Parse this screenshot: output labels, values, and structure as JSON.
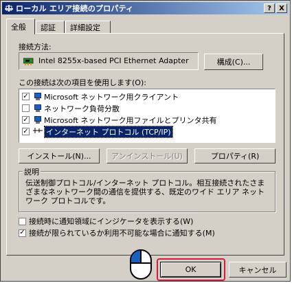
{
  "window": {
    "title": "ローカル エリア接続のプロパティ",
    "help_button": "?",
    "close_button": "X"
  },
  "tabs": [
    {
      "label": "全般",
      "active": true
    },
    {
      "label": "認証",
      "active": false
    },
    {
      "label": "詳細設定",
      "active": false
    }
  ],
  "connection": {
    "method_label": "接続方法:",
    "adapter_name": "Intel 8255x-based PCI Ethernet Adapter",
    "configure_button": "構成(C)..."
  },
  "items_section": {
    "label": "この接続は次の項目を使用します(O):",
    "items": [
      {
        "label": "Microsoft ネットワーク用クライアント",
        "checked": true,
        "icon": "network-client-icon",
        "selected": false
      },
      {
        "label": "ネットワーク負荷分散",
        "checked": false,
        "icon": "network-service-icon",
        "selected": false
      },
      {
        "label": "Microsoft ネットワーク用ファイルとプリンタ共有",
        "checked": true,
        "icon": "network-service-icon",
        "selected": false
      },
      {
        "label": "インターネット プロトコル (TCP/IP)",
        "checked": true,
        "icon": "protocol-icon",
        "selected": true
      }
    ]
  },
  "buttons": {
    "install": "インストール(N)...",
    "uninstall": "アンインストール(U)",
    "properties": "プロパティ(R)"
  },
  "description": {
    "title": "説明",
    "text": "伝送制御プロトコル/インターネット プロトコル。相互接続されたさまざまなネットワーク間の通信を提供する、既定のワイド エリア ネットワーク プロトコルです。"
  },
  "options": [
    {
      "label": "接続時に通知領域にインジケータを表示する(W)",
      "checked": false
    },
    {
      "label": "接続が限られているか利用不可能な場合に通知する(M)",
      "checked": true
    }
  ],
  "footer": {
    "ok": "OK",
    "cancel": "キャンセル"
  },
  "colors": {
    "titlebar_start": "#0a246a",
    "titlebar_end": "#a6caf0",
    "highlight": "#d61b3a",
    "selection": "#0a246a"
  }
}
